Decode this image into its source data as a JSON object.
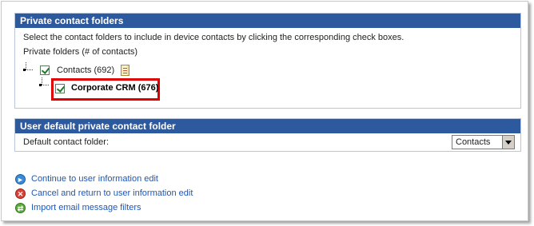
{
  "private_section": {
    "title": "Private contact folders",
    "instructions": "Select the contact folders to include in device contacts by clicking the corresponding check boxes.",
    "folders_label": "Private folders (# of contacts)",
    "folders": [
      {
        "label": "Contacts (692)",
        "checked": true
      },
      {
        "label": "Corporate CRM (676)",
        "checked": true
      }
    ]
  },
  "default_section": {
    "title": "User default private contact folder",
    "default_label": "Default contact folder:",
    "default_value": "Contacts"
  },
  "links": [
    {
      "label": "Continue to user information edit",
      "icon": "continue-arrow-icon"
    },
    {
      "label": "Cancel and return to user information edit",
      "icon": "cancel-x-icon"
    },
    {
      "label": "Import email message filters",
      "icon": "import-icon"
    }
  ],
  "colors": {
    "header_bg": "#2d5a9e",
    "link": "#1f57b5",
    "highlight_border": "#e00000"
  }
}
